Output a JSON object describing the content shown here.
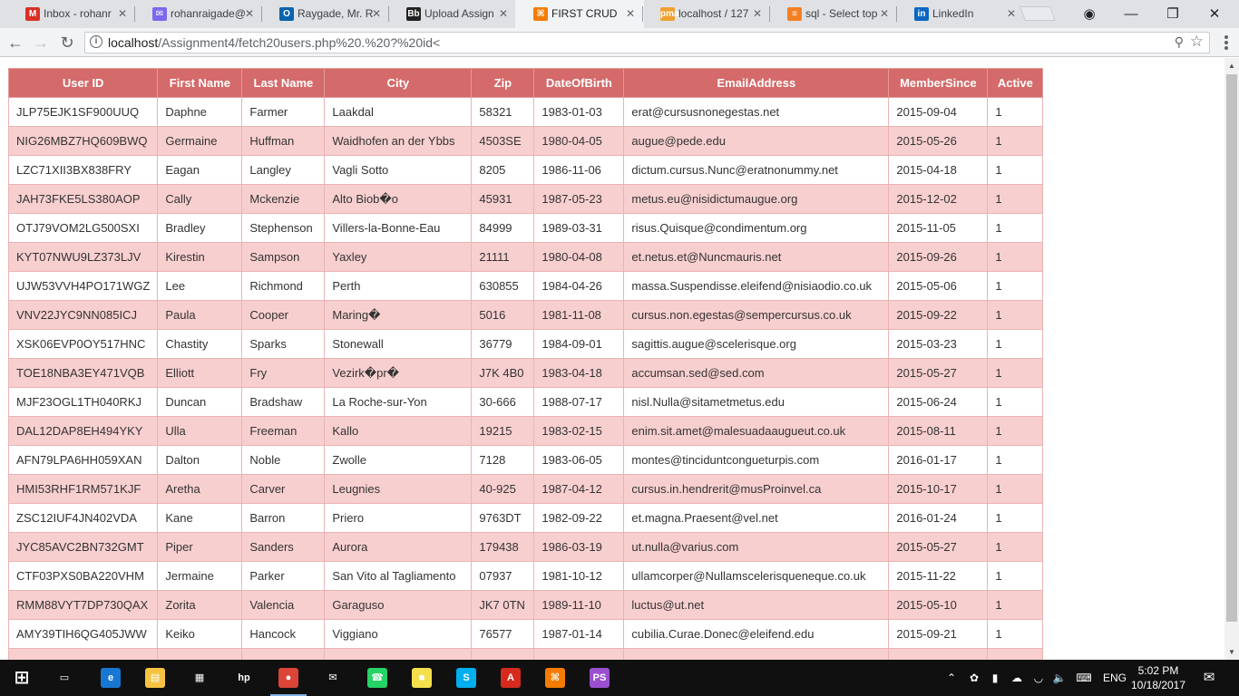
{
  "browser": {
    "tabs": [
      {
        "title": "Inbox - rohanr",
        "icon": "gmail-icon",
        "color": "#d93025",
        "glyph": "M"
      },
      {
        "title": "rohanraigade@",
        "icon": "yahoo-mail-icon",
        "color": "#7b68ee",
        "glyph": "✉"
      },
      {
        "title": "Raygade, Mr. R",
        "icon": "outlook-icon",
        "color": "#0a64ad",
        "glyph": "O"
      },
      {
        "title": "Upload Assign",
        "icon": "blackboard-icon",
        "color": "#222222",
        "glyph": "Bb"
      },
      {
        "title": "FIRST CRUD",
        "icon": "xampp-icon",
        "color": "#f57c00",
        "glyph": "⌘",
        "active": true
      },
      {
        "title": "localhost / 127",
        "icon": "phpmyadmin-icon",
        "color": "#f0a030",
        "glyph": "pma"
      },
      {
        "title": "sql - Select top",
        "icon": "stackoverflow-icon",
        "color": "#f48024",
        "glyph": "≡"
      },
      {
        "title": "LinkedIn",
        "icon": "linkedin-icon",
        "color": "#0a66c2",
        "glyph": "in"
      }
    ],
    "url_host": "localhost",
    "url_path": "/Assignment4/fetch20users.php%20.%20?%20id<"
  },
  "table": {
    "headers": [
      "User ID",
      "First Name",
      "Last Name",
      "City",
      "Zip",
      "DateOfBirth",
      "EmailAddress",
      "MemberSince",
      "Active"
    ],
    "rows": [
      [
        "JLP75EJK1SF900UUQ",
        "Daphne",
        "Farmer",
        "Laakdal",
        "58321",
        "1983-01-03",
        "erat@cursusnonegestas.net",
        "2015-09-04",
        "1"
      ],
      [
        "NIG26MBZ7HQ609BWQ",
        "Germaine",
        "Huffman",
        "Waidhofen an der Ybbs",
        "4503SE",
        "1980-04-05",
        "augue@pede.edu",
        "2015-05-26",
        "1"
      ],
      [
        "LZC71XII3BX838FRY",
        "Eagan",
        "Langley",
        "Vagli Sotto",
        "8205",
        "1986-11-06",
        "dictum.cursus.Nunc@eratnonummy.net",
        "2015-04-18",
        "1"
      ],
      [
        "JAH73FKE5LS380AOP",
        "Cally",
        "Mckenzie",
        "Alto Biob�o",
        "45931",
        "1987-05-23",
        "metus.eu@nisidictumaugue.org",
        "2015-12-02",
        "1"
      ],
      [
        "OTJ79VOM2LG500SXI",
        "Bradley",
        "Stephenson",
        "Villers-la-Bonne-Eau",
        "84999",
        "1989-03-31",
        "risus.Quisque@condimentum.org",
        "2015-11-05",
        "1"
      ],
      [
        "KYT07NWU9LZ373LJV",
        "Kirestin",
        "Sampson",
        "Yaxley",
        "21111",
        "1980-04-08",
        "et.netus.et@Nuncmauris.net",
        "2015-09-26",
        "1"
      ],
      [
        "UJW53VVH4PO171WGZ",
        "Lee",
        "Richmond",
        "Perth",
        "630855",
        "1984-04-26",
        "massa.Suspendisse.eleifend@nisiaodio.co.uk",
        "2015-05-06",
        "1"
      ],
      [
        "VNV22JYC9NN085ICJ",
        "Paula",
        "Cooper",
        "Maring�",
        "5016",
        "1981-11-08",
        "cursus.non.egestas@sempercursus.co.uk",
        "2015-09-22",
        "1"
      ],
      [
        "XSK06EVP0OY517HNC",
        "Chastity",
        "Sparks",
        "Stonewall",
        "36779",
        "1984-09-01",
        "sagittis.augue@scelerisque.org",
        "2015-03-23",
        "1"
      ],
      [
        "TOE18NBA3EY471VQB",
        "Elliott",
        "Fry",
        "Vezirk�pr�",
        "J7K 4B0",
        "1983-04-18",
        "accumsan.sed@sed.com",
        "2015-05-27",
        "1"
      ],
      [
        "MJF23OGL1TH040RKJ",
        "Duncan",
        "Bradshaw",
        "La Roche-sur-Yon",
        "30-666",
        "1988-07-17",
        "nisl.Nulla@sitametmetus.edu",
        "2015-06-24",
        "1"
      ],
      [
        "DAL12DAP8EH494YKY",
        "Ulla",
        "Freeman",
        "Kallo",
        "19215",
        "1983-02-15",
        "enim.sit.amet@malesuadaaugueut.co.uk",
        "2015-08-11",
        "1"
      ],
      [
        "AFN79LPA6HH059XAN",
        "Dalton",
        "Noble",
        "Zwolle",
        "7128",
        "1983-06-05",
        "montes@tinciduntcongueturpis.com",
        "2016-01-17",
        "1"
      ],
      [
        "HMI53RHF1RM571KJF",
        "Aretha",
        "Carver",
        "Leugnies",
        "40-925",
        "1987-04-12",
        "cursus.in.hendrerit@musProinvel.ca",
        "2015-10-17",
        "1"
      ],
      [
        "ZSC12IUF4JN402VDA",
        "Kane",
        "Barron",
        "Priero",
        "9763DT",
        "1982-09-22",
        "et.magna.Praesent@vel.net",
        "2016-01-24",
        "1"
      ],
      [
        "JYC85AVC2BN732GMT",
        "Piper",
        "Sanders",
        "Aurora",
        "179438",
        "1986-03-19",
        "ut.nulla@varius.com",
        "2015-05-27",
        "1"
      ],
      [
        "CTF03PXS0BA220VHM",
        "Jermaine",
        "Parker",
        "San Vito al Tagliamento",
        "07937",
        "1981-10-12",
        "ullamcorper@Nullamscelerisqueneque.co.uk",
        "2015-11-22",
        "1"
      ],
      [
        "RMM88VYT7DP730QAX",
        "Zorita",
        "Valencia",
        "Garaguso",
        "JK7 0TN",
        "1989-11-10",
        "luctus@ut.net",
        "2015-05-10",
        "1"
      ],
      [
        "AMY39TIH6QG405JWW",
        "Keiko",
        "Hancock",
        "Viggiano",
        "76577",
        "1987-01-14",
        "cubilia.Curae.Donec@eleifend.edu",
        "2015-09-21",
        "1"
      ]
    ]
  },
  "taskbar": {
    "apps": [
      {
        "name": "start-button",
        "glyph": "⊞",
        "color": "#101010"
      },
      {
        "name": "task-view-icon",
        "glyph": "▭",
        "color": "#101010"
      },
      {
        "name": "edge-icon",
        "glyph": "e",
        "color": "#1877d2"
      },
      {
        "name": "file-explorer-icon",
        "glyph": "▤",
        "color": "#f5c242"
      },
      {
        "name": "store-icon",
        "glyph": "▦",
        "color": "#101010"
      },
      {
        "name": "hp-icon",
        "glyph": "hp",
        "color": "#101010"
      },
      {
        "name": "chrome-icon",
        "glyph": "●",
        "color": "#db4437",
        "running": true
      },
      {
        "name": "mail-icon",
        "glyph": "✉",
        "color": "#101010"
      },
      {
        "name": "whatsapp-icon",
        "glyph": "☎",
        "color": "#25d366"
      },
      {
        "name": "sticky-notes-icon",
        "glyph": "■",
        "color": "#f4e04d"
      },
      {
        "name": "skype-icon",
        "glyph": "S",
        "color": "#00aff0"
      },
      {
        "name": "acrobat-icon",
        "glyph": "A",
        "color": "#d52b1e"
      },
      {
        "name": "xampp-icon",
        "glyph": "⌘",
        "color": "#f57c00"
      },
      {
        "name": "phpstorm-icon",
        "glyph": "PS",
        "color": "#9b4fcf"
      }
    ],
    "language": "ENG",
    "time": "5:02 PM",
    "date": "10/18/2017"
  }
}
